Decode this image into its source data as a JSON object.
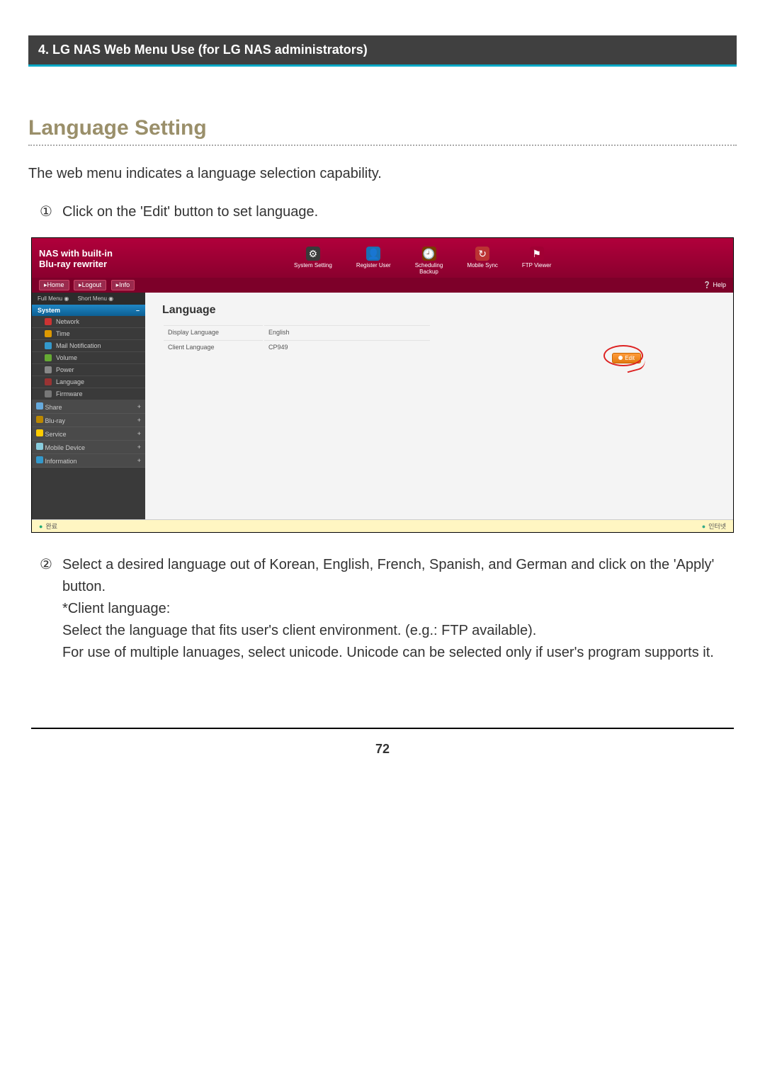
{
  "chapter_bar": "4. LG NAS Web Menu Use (for LG NAS administrators)",
  "section_title": "Language Setting",
  "intro": "The web menu indicates a language selection capability.",
  "steps": {
    "s1_num": "①",
    "s1_text": "Click on the 'Edit' button to set language.",
    "s2_num": "②",
    "s2_text": "Select a desired language out of Korean, English, French, Spanish, and German and click on the 'Apply' button.\n*Client language:\nSelect the language that fits user's client environment. (e.g.: FTP available).\nFor use of multiple lanuages, select unicode. Unicode can be selected only if user's program supports it."
  },
  "screenshot": {
    "logo_line1": "NAS with built-in",
    "logo_line2": "Blu-ray rewriter",
    "topnav": {
      "system_setting": "System Setting",
      "register_user": "Register User",
      "scheduling_backup": "Scheduling\nBackup",
      "mobile_sync": "Mobile Sync",
      "ftp_viewer": "FTP Viewer"
    },
    "rowbtn_home": "▸Home",
    "rowbtn_logout": "▸Logout",
    "rowbtn_info": "▸Info",
    "help_label": "Help",
    "menu_toggle_full": "Full Menu",
    "menu_toggle_short": "Short Menu",
    "group_system": "System",
    "items": {
      "network": "Network",
      "time": "Time",
      "mail": "Mail Notification",
      "volume": "Volume",
      "power": "Power",
      "language": "Language",
      "firmware": "Firmware"
    },
    "cats": {
      "share": "Share",
      "bluray": "Blu-ray",
      "service": "Service",
      "mobile": "Mobile Device",
      "info": "Information"
    },
    "panel_title": "Language",
    "kv_display_language": "Display Language",
    "kv_display_language_val": "English",
    "kv_client_language": "Client Language",
    "kv_client_language_val": "CP949",
    "edit_btn": "Edit",
    "status_left": "완료",
    "status_right": "인터넷"
  },
  "page_number": "72"
}
